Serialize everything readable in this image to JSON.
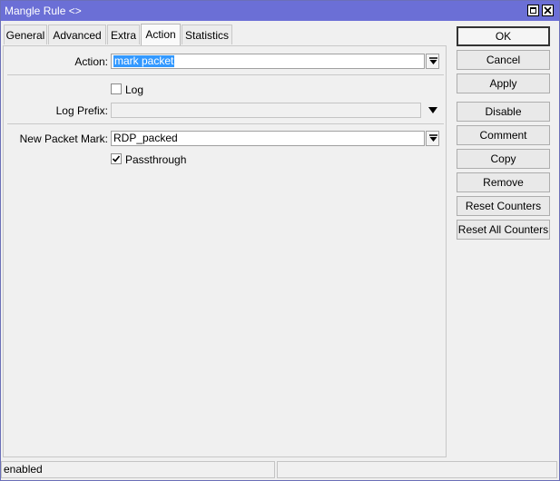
{
  "window": {
    "title": "Mangle Rule <>"
  },
  "tabs": [
    {
      "label": "General"
    },
    {
      "label": "Advanced"
    },
    {
      "label": "Extra"
    },
    {
      "label": "Action"
    },
    {
      "label": "Statistics"
    }
  ],
  "active_tab": "Action",
  "form": {
    "action": {
      "label": "Action:",
      "value": "mark packet"
    },
    "log": {
      "label": "Log",
      "checked": false
    },
    "log_prefix": {
      "label": "Log Prefix:",
      "value": ""
    },
    "new_packet_mark": {
      "label": "New Packet Mark:",
      "value": "RDP_packed"
    },
    "passthrough": {
      "label": "Passthrough",
      "checked": true
    }
  },
  "buttons": {
    "ok": "OK",
    "cancel": "Cancel",
    "apply": "Apply",
    "disable": "Disable",
    "comment": "Comment",
    "copy": "Copy",
    "remove": "Remove",
    "reset_counters": "Reset Counters",
    "reset_all_counters": "Reset All Counters"
  },
  "status": {
    "state": "enabled"
  },
  "colors": {
    "titlebar": "#6b6fd6",
    "selection": "#3399ff"
  }
}
